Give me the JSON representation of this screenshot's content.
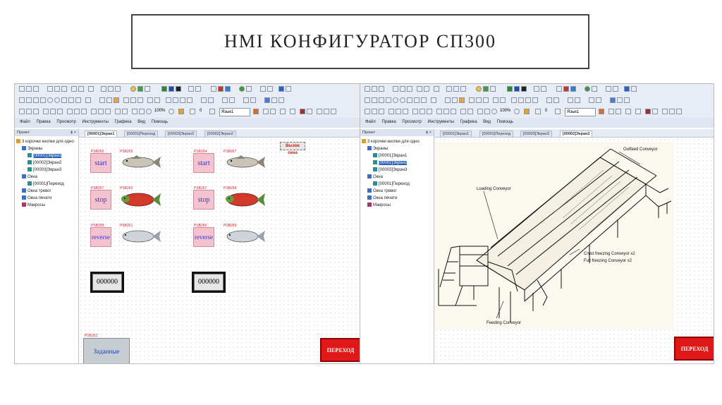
{
  "slide": {
    "title": "HMI КОНФИГУРАТОР СП300"
  },
  "menu": [
    "Файл",
    "Правка",
    "Просмотр",
    "Инструменты",
    "Графика",
    "Вид",
    "Помощь"
  ],
  "project": {
    "header": "Проект",
    "pin": "ϕ ×",
    "root": "3 корочки кнопки для одно",
    "screens_folder": "Экраны",
    "screens": [
      "[00001]Экран1",
      "[00002]Экран2",
      "[00003]Экран3"
    ],
    "windows_folder": "Окна",
    "windows": [
      "[00001]Переход"
    ],
    "alarm": "Окна тревог",
    "print": "Окна печати",
    "macros": "Макросы"
  },
  "toolbar": {
    "zoom": "100%",
    "value": "0",
    "language": "Язык1"
  },
  "left_window": {
    "tabs": [
      "[00001]Экран1",
      "[00001]Переход",
      "[00003]Экран3",
      "[00002]Экран2"
    ],
    "active_tab": 0,
    "buttons": [
      {
        "id": "PSB265",
        "label": "start"
      },
      {
        "id": "PSB257",
        "label": "stop"
      },
      {
        "id": "PSB258",
        "label": "reverse"
      },
      {
        "id": "PSB264",
        "label": "start"
      },
      {
        "id": "PSB267",
        "label": "stop"
      },
      {
        "id": "PSB266",
        "label": "reverse"
      }
    ],
    "fish_labels": [
      "PSB269",
      "PSB260",
      "PSB261",
      "PSB267",
      "PSB268",
      "PSB269"
    ],
    "counter_left": "000000",
    "counter_right": "000000",
    "zadannye_id": "PSB262",
    "zadannye_label": "Заданные",
    "perekhod_label": "ПЕРЕХОД",
    "vyzov": "Вызов окна"
  },
  "right_window": {
    "tabs": [
      "[00001]Экран1",
      "[00001]Переход",
      "[00003]Экран3",
      "[00002]Экран2"
    ],
    "active_tab": 3,
    "diagram_labels": {
      "outfeed": "Outfeed Conveyor",
      "loading": "Loading Conveyor",
      "crust": "Crust freezing Conveyor x2",
      "full": "Full freezing Conveyor x2",
      "feeding": "Feeding Conveyor"
    },
    "perekhod_label": "ПЕРЕХОД"
  },
  "colors": {
    "button_pink": "#f5c3cf",
    "button_text": "#3535c9",
    "psb_red": "#dd2222",
    "go_red": "#e01818",
    "tree_select": "#2a5fb8"
  }
}
